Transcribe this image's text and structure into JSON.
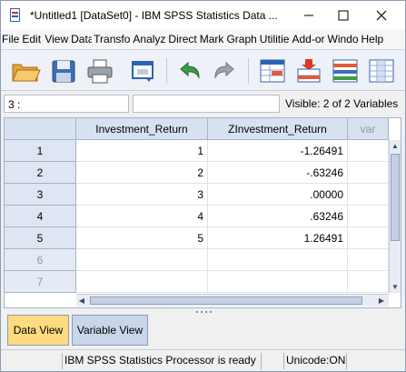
{
  "window": {
    "title": "*Untitled1 [DataSet0] - IBM SPSS Statistics Data ..."
  },
  "menu": [
    "File",
    "Edit",
    "View",
    "Data",
    "Transfo",
    "Analyz",
    "Direct",
    "Mark",
    "Graph",
    "Utilitie",
    "Add-or",
    "Windo",
    "Help"
  ],
  "toolbar": {
    "icons": [
      "open-folder-icon",
      "save-icon",
      "print-icon",
      "dialog-recall-icon",
      "undo-icon",
      "redo-icon",
      "go-to-case-icon",
      "insert-cases-icon",
      "variables-icon",
      "grid-icon"
    ]
  },
  "editor": {
    "cell_ref": "3 :",
    "cell_value": "",
    "visible": "Visible: 2 of 2 Variables"
  },
  "grid": {
    "columns": [
      "Investment_Return",
      "ZInvestment_Return",
      "var"
    ],
    "row_labels": [
      "1",
      "2",
      "3",
      "4",
      "5",
      "6",
      "7"
    ],
    "rows": [
      [
        "1",
        "-1.26491"
      ],
      [
        "2",
        "-.63246"
      ],
      [
        "3",
        ".00000"
      ],
      [
        "4",
        ".63246"
      ],
      [
        "5",
        "1.26491"
      ]
    ]
  },
  "tabs": {
    "data_view": "Data View",
    "variable_view": "Variable View"
  },
  "status": {
    "processor": "IBM SPSS Statistics Processor is ready",
    "unicode": "Unicode:ON"
  },
  "colors": {
    "active_tab": "#fddb7e",
    "header_bg": "#d8e1ef"
  }
}
